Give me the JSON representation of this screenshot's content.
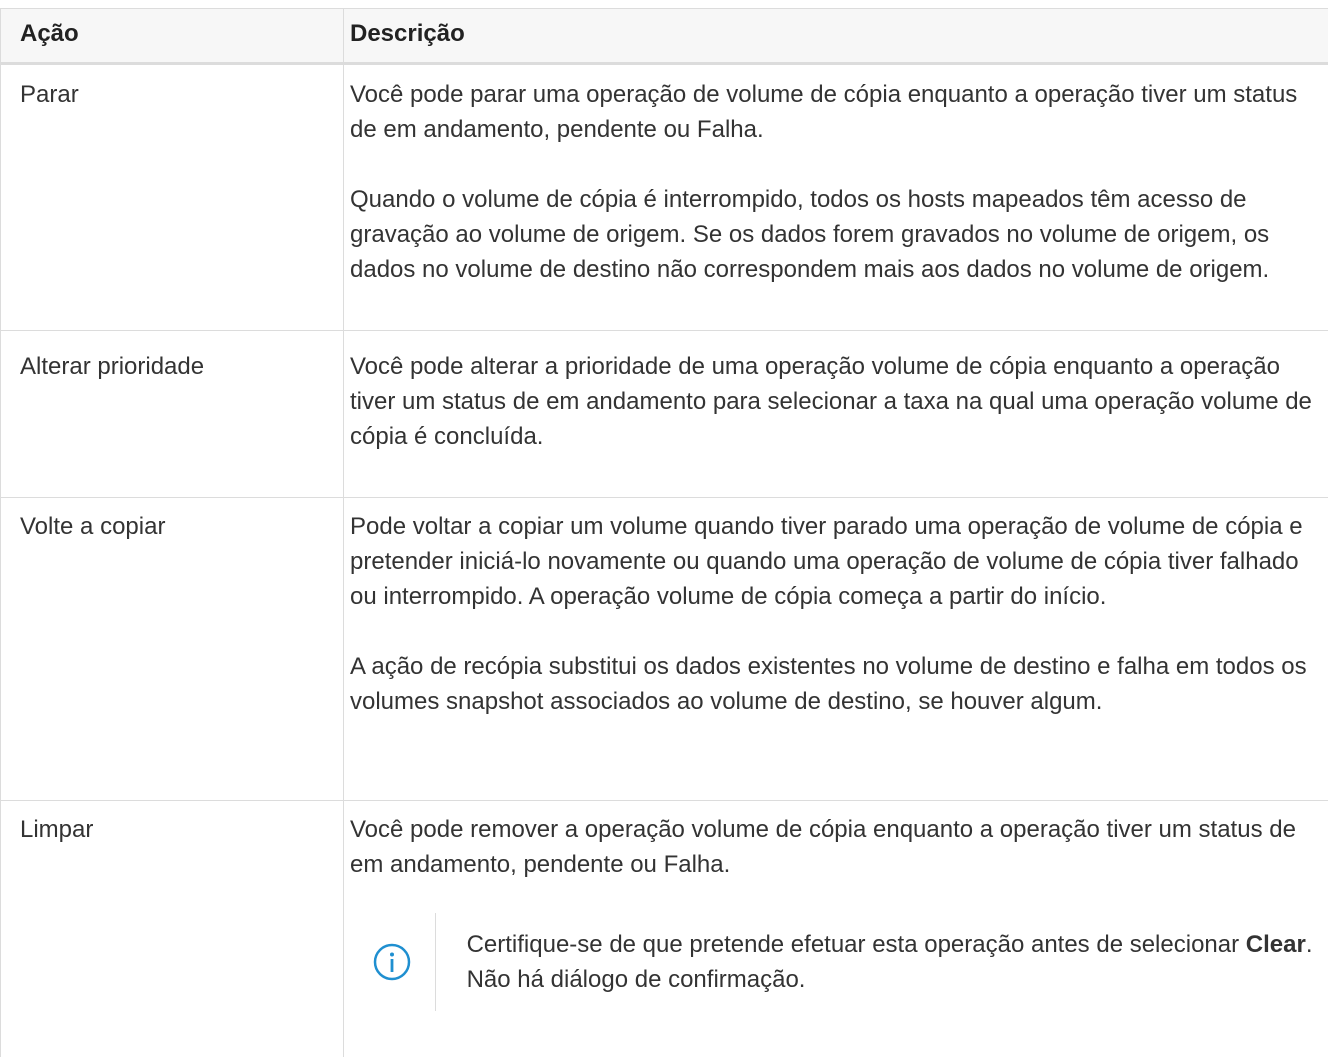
{
  "table": {
    "headers": {
      "action": "Ação",
      "description": "Descrição"
    },
    "rows": [
      {
        "action": "Parar",
        "p1": "Você pode parar uma operação de volume de cópia enquanto a operação tiver um status de em andamento, pendente ou Falha.",
        "p2": "Quando o volume de cópia é interrompido, todos os hosts mapeados têm acesso de gravação ao volume de origem. Se os dados forem gravados no volume de origem, os dados no volume de destino não correspondem mais aos dados no volume de origem."
      },
      {
        "action": "Alterar prioridade",
        "p1": "Você pode alterar a prioridade de uma operação volume de cópia enquanto a operação tiver um status de em andamento para selecionar a taxa na qual uma operação volume de cópia é concluída."
      },
      {
        "action": "Volte a copiar",
        "p1": "Pode voltar a copiar um volume quando tiver parado uma operação de volume de cópia e pretender iniciá-lo novamente ou quando uma operação de volume de cópia tiver falhado ou interrompido. A operação volume de cópia começa a partir do início.",
        "p2": "A ação de recópia substitui os dados existentes no volume de destino e falha em todos os volumes snapshot associados ao volume de destino, se houver algum."
      },
      {
        "action": "Limpar",
        "p1": "Você pode remover a operação volume de cópia enquanto a operação tiver um status de em andamento, pendente ou Falha.",
        "note": {
          "icon": "info-icon",
          "before": "Certifique-se de que pretende efetuar esta operação antes de selecionar ",
          "strong": "Clear",
          "after": ". Não há diálogo de confirmação."
        }
      }
    ]
  },
  "colors": {
    "text": "#333333",
    "border": "#dcdcdc",
    "header_bg": "#f7f7f7",
    "info_icon": "#1f8fd0"
  }
}
